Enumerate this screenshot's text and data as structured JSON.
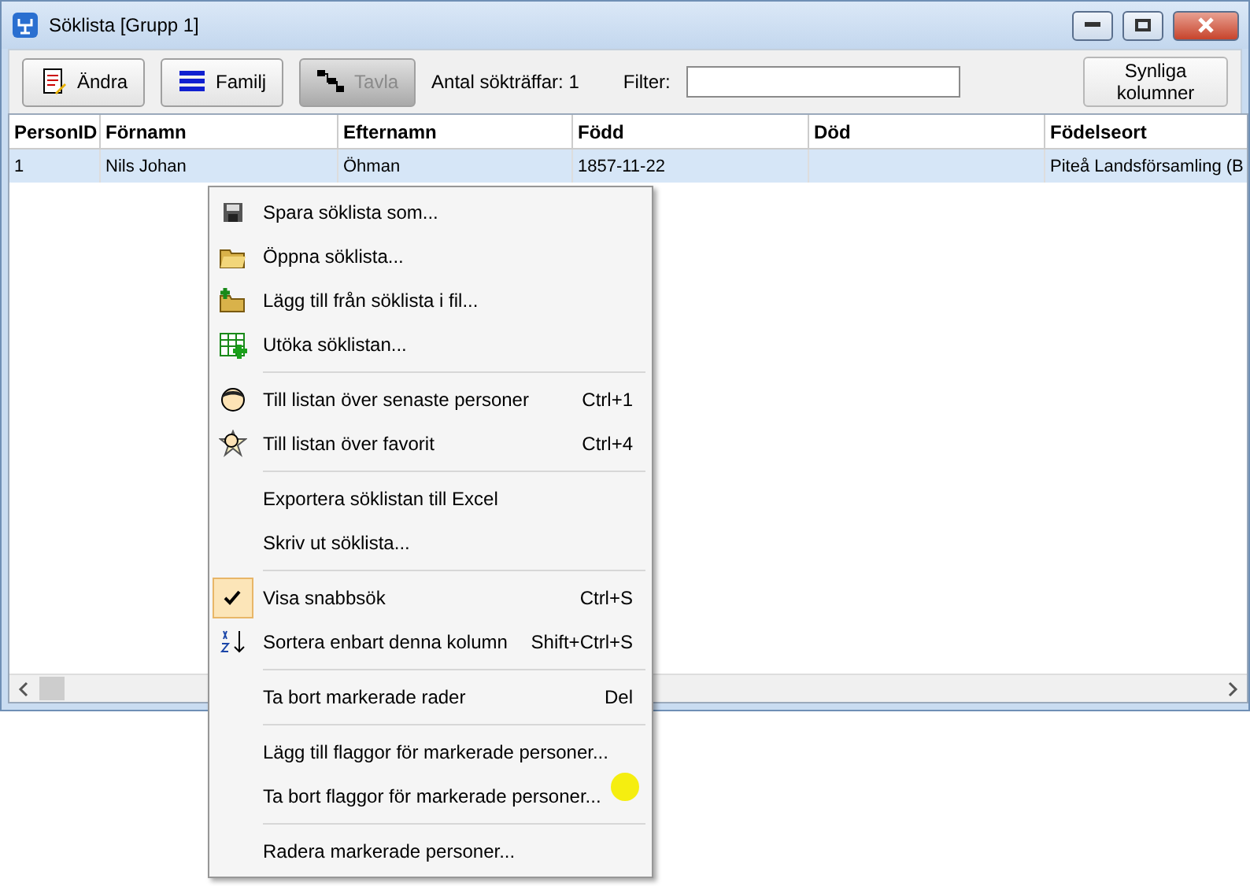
{
  "window": {
    "title": "Söklista [Grupp 1]"
  },
  "toolbar": {
    "buttons": [
      {
        "label": "Ändra",
        "disabled": false
      },
      {
        "label": "Familj",
        "disabled": false
      },
      {
        "label": "Tavla",
        "disabled": true
      }
    ],
    "hit_count": "Antal sökträffar: 1",
    "filter": {
      "label": "Filter:"
    },
    "columns_button": "Synliga kolumner"
  },
  "table": {
    "columns": [
      "PersonID",
      "Förnamn",
      "Efternamn",
      "Född",
      "Död",
      "Födelseort"
    ],
    "rows": [
      {
        "selected": true,
        "cells": [
          "1",
          "Nils Johan",
          "Öhman",
          "1857-11-22",
          "",
          "Piteå Landsförsamling (B"
        ]
      }
    ]
  },
  "context_menu": {
    "items": [
      {
        "kind": "item",
        "label": "Spara söklista som...",
        "checked": false
      },
      {
        "kind": "item",
        "label": "Öppna söklista...",
        "checked": false
      },
      {
        "kind": "item",
        "label": "Lägg till från söklista i fil...",
        "checked": false
      },
      {
        "kind": "item",
        "label": "Utöka söklistan...",
        "checked": false
      },
      {
        "kind": "separator"
      },
      {
        "kind": "item",
        "label": "Till listan över senaste personer",
        "shortcut": "Ctrl+1",
        "checked": false
      },
      {
        "kind": "item",
        "label": "Till listan över favorit",
        "shortcut": "Ctrl+4",
        "checked": false
      },
      {
        "kind": "separator"
      },
      {
        "kind": "item",
        "label": "Exportera söklistan till Excel",
        "checked": false
      },
      {
        "kind": "item",
        "label": "Skriv ut söklista...",
        "checked": false
      },
      {
        "kind": "separator"
      },
      {
        "kind": "item",
        "label": "Visa snabbsök",
        "shortcut": "Ctrl+S",
        "checked": true
      },
      {
        "kind": "item",
        "label": "Sortera enbart denna kolumn",
        "shortcut": "Shift+Ctrl+S",
        "checked": false
      },
      {
        "kind": "separator"
      },
      {
        "kind": "item",
        "label": "Ta bort markerade rader",
        "shortcut": "Del",
        "checked": false
      },
      {
        "kind": "separator"
      },
      {
        "kind": "item",
        "label": "Lägg till flaggor för markerade personer...",
        "checked": false
      },
      {
        "kind": "item",
        "label": "Ta bort flaggor för markerade personer...",
        "checked": false
      },
      {
        "kind": "separator"
      },
      {
        "kind": "item",
        "label": "Radera markerade personer...",
        "checked": false
      }
    ]
  }
}
